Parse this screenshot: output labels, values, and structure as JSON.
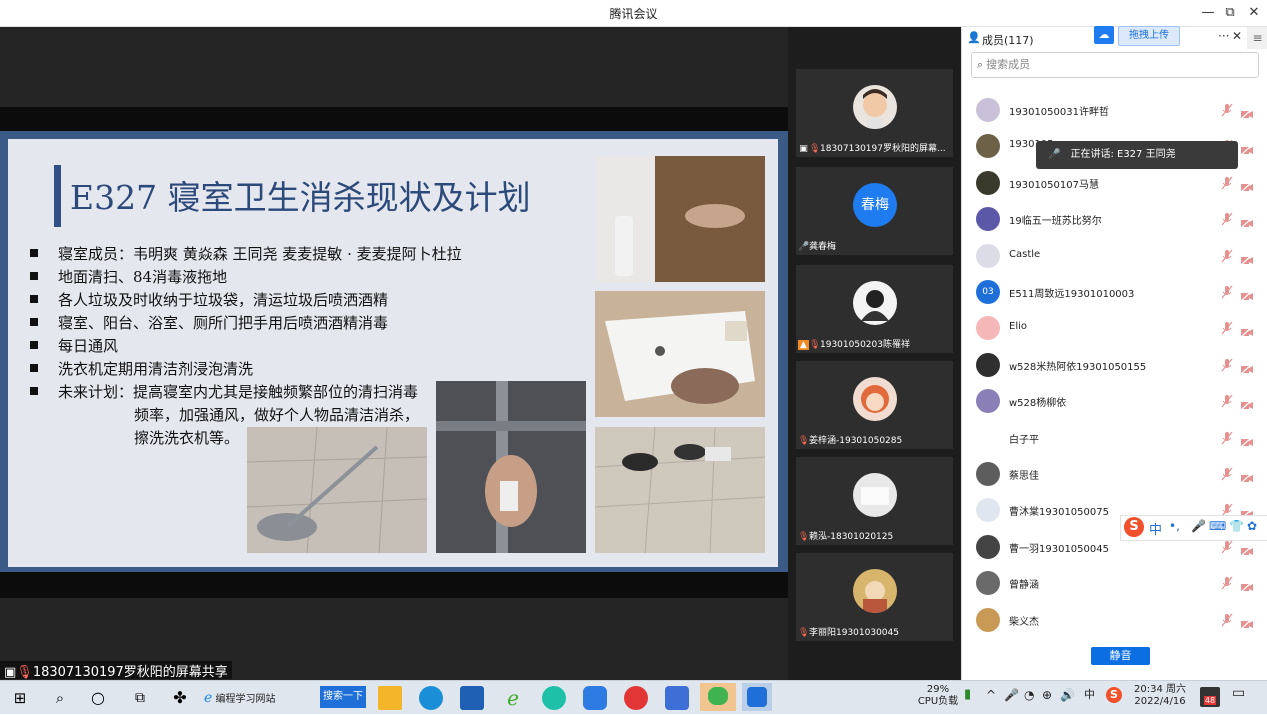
{
  "window": {
    "title": "腾讯会议",
    "minimize": "—",
    "restore": "⧉",
    "close": "✕"
  },
  "slide": {
    "title": "E327 寝室卫生消杀现状及计划",
    "bullets": [
      "寝室成员：韦明爽 黄焱森 王同尧 麦麦提敏 · 麦麦提阿卜杜拉",
      "地面清扫、84消毒液拖地",
      "各人垃圾及时收纳于垃圾袋，清运垃圾后喷洒酒精",
      "寝室、阳台、浴室、厕所门把手用后喷洒酒精消毒",
      "每日通风",
      "洗衣机定期用清洁剂浸泡清洗",
      "未来计划：提高寝室内尤其是接触频繁部位的清扫消毒"
    ],
    "continuation": [
      "频率，加强通风，做好个人物品清洁消杀，",
      "擦洗洗衣机等。"
    ]
  },
  "share_label": "18307130197罗秋阳的屏幕共享",
  "video_tiles": [
    {
      "name": "18307130197罗秋阳的屏幕...",
      "avatar_text": ""
    },
    {
      "name": "龚春梅",
      "avatar_text": "春梅"
    },
    {
      "name": "19301050203陈罹祥",
      "avatar_text": ""
    },
    {
      "name": "姜梓涵-19301050285",
      "avatar_text": ""
    },
    {
      "name": "赖泓-18301020125",
      "avatar_text": ""
    },
    {
      "name": "李丽阳19301030045",
      "avatar_text": ""
    }
  ],
  "members_panel": {
    "title": "成员(117)",
    "upload_label": "拖拽上传",
    "more_label": "···",
    "close_label": "✕",
    "search_placeholder": "搜索成员",
    "speaking_text": "正在讲话: E327 王同尧",
    "members": [
      {
        "name": "19301050031许畔哲",
        "badge": ""
      },
      {
        "name": "1930105",
        "badge": ""
      },
      {
        "name": "19301050107马慧",
        "badge": ""
      },
      {
        "name": "19临五一班苏比努尔",
        "badge": ""
      },
      {
        "name": "Castle",
        "badge": ""
      },
      {
        "name": "E511周致远19301010003",
        "badge": "03"
      },
      {
        "name": "Elio",
        "badge": ""
      },
      {
        "name": "w528米热阿依19301050155",
        "badge": ""
      },
      {
        "name": "w528杨柳依",
        "badge": ""
      },
      {
        "name": "白子平",
        "badge": ""
      },
      {
        "name": "蔡思佳",
        "badge": ""
      },
      {
        "name": "曹沐棠19301050075",
        "badge": ""
      },
      {
        "name": "曹一羽19301050045",
        "badge": ""
      },
      {
        "name": "曾静涵",
        "badge": ""
      },
      {
        "name": "柴义杰",
        "badge": ""
      }
    ],
    "mute_all_label": "静音",
    "ime_label": "中"
  },
  "taskbar": {
    "browser_label": "编程学习网站",
    "search_button": "搜索一下",
    "cpu_percent": "29%",
    "cpu_label": "CPU负载",
    "time": "20:34 周六",
    "date": "2022/4/16",
    "notif_count": "48"
  },
  "colors": {
    "accent": "#0b6fe3",
    "slide_frame": "#3c5a86",
    "slide_title": "#2b4a7a",
    "muted_red": "#e6908f"
  }
}
